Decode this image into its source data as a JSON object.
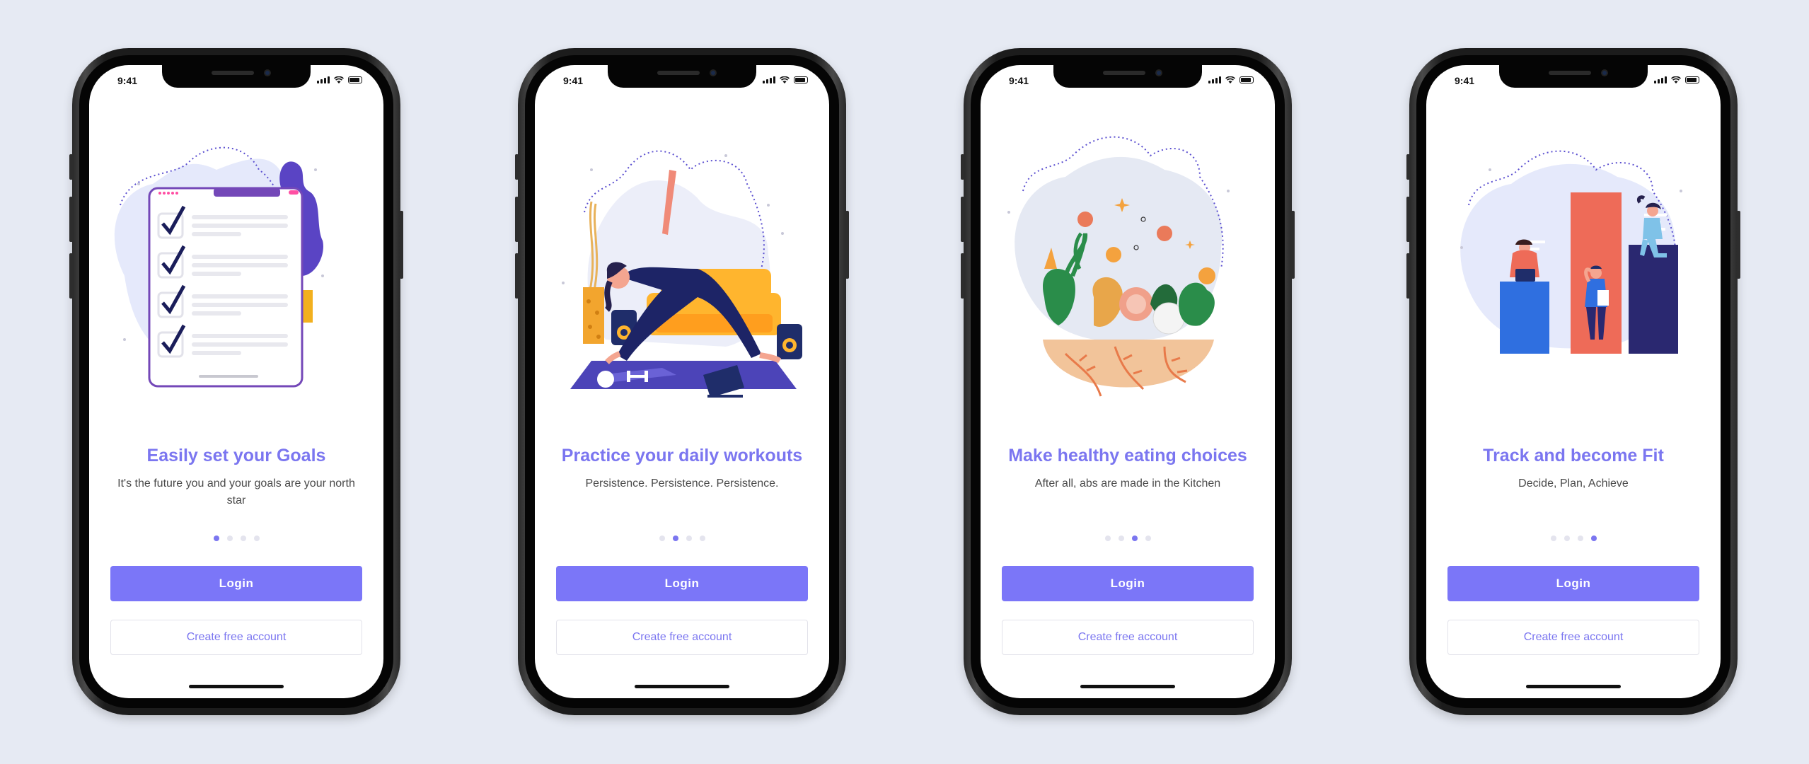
{
  "status_time": "9:41",
  "screens": [
    {
      "title": "Easily set your Goals",
      "subtitle": "It's the future you and your goals are your north star",
      "active_dot": 0,
      "login_label": "Login",
      "create_label": "Create free account",
      "illustration": "goals-checklist-icon"
    },
    {
      "title": "Practice your daily workouts",
      "subtitle": "Persistence. Persistence. Persistence.",
      "active_dot": 1,
      "login_label": "Login",
      "create_label": "Create free account",
      "illustration": "yoga-workout-icon"
    },
    {
      "title": "Make healthy eating choices",
      "subtitle": "After all, abs are made in the Kitchen",
      "active_dot": 2,
      "login_label": "Login",
      "create_label": "Create free account",
      "illustration": "healthy-food-bowl-icon"
    },
    {
      "title": "Track and become Fit",
      "subtitle": "Decide, Plan, Achieve",
      "active_dot": 3,
      "login_label": "Login",
      "create_label": "Create free account",
      "illustration": "progress-chart-icon"
    }
  ],
  "colors": {
    "background": "#e6eaf3",
    "accent": "#7b76f8",
    "title": "#7b76f0",
    "subtitle": "#4a4a4a",
    "dot_inactive": "#e4e4ee"
  }
}
